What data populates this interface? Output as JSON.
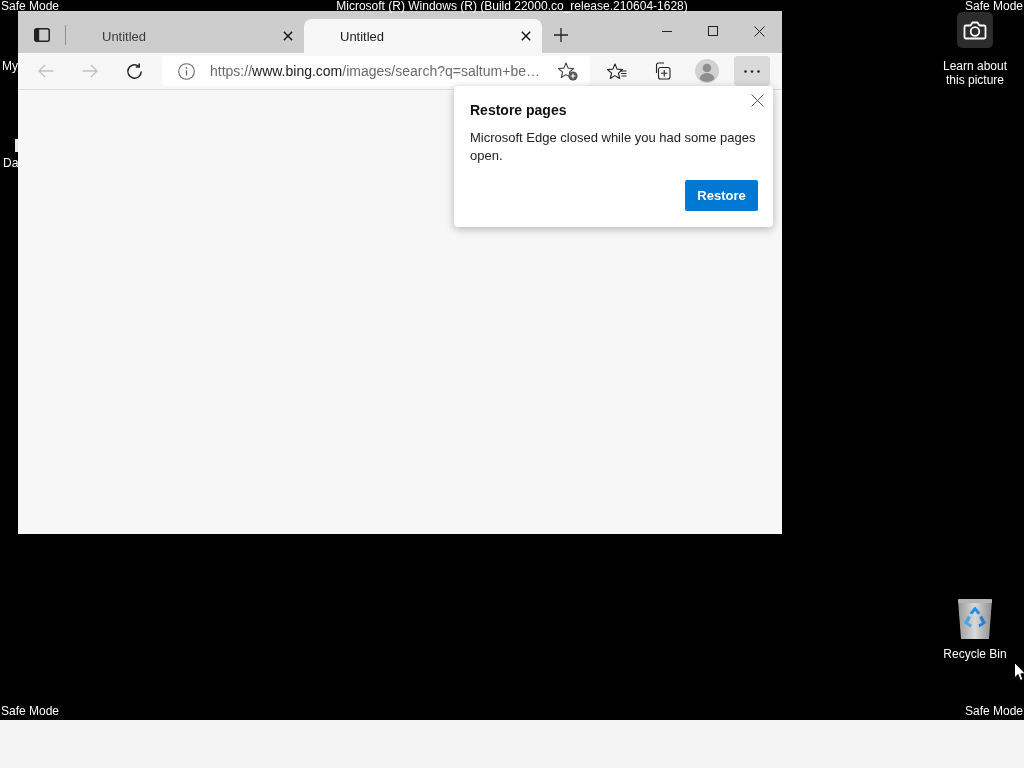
{
  "desktop": {
    "corner_labels": [
      "Safe Mode",
      "Safe Mode",
      "Safe Mode",
      "Safe Mode"
    ],
    "build_text": "Microsoft (R) Windows (R) (Build 22000.co_release.210604-1628)",
    "icons": [
      {
        "kind": "covered",
        "label": "My"
      },
      {
        "kind": "file",
        "label": "Da"
      },
      {
        "kind": "camera",
        "label": "Learn about this picture"
      },
      {
        "kind": "recycle-bin",
        "label": "Recycle Bin"
      }
    ]
  },
  "browser": {
    "tabs": [
      {
        "title": "Untitled",
        "selected": false
      },
      {
        "title": "Untitled",
        "selected": true
      }
    ],
    "navigation": [
      {
        "kind": "back",
        "disabled": true
      },
      {
        "kind": "forward",
        "disabled": true
      },
      {
        "kind": "refresh",
        "disabled": false
      }
    ],
    "address_bar": {
      "scheme": "https://",
      "host": "www.bing.com",
      "path": "/images/search?q=saltum+be…"
    },
    "toolbar_buttons": [
      {
        "kind": "favorites",
        "pressed": false
      },
      {
        "kind": "collections",
        "pressed": false
      },
      {
        "kind": "profile",
        "pressed": false
      },
      {
        "kind": "more",
        "pressed": true
      }
    ],
    "popup": {
      "title": "Restore pages",
      "message": "Microsoft Edge closed while you had some pages open.",
      "button": "Restore"
    }
  }
}
